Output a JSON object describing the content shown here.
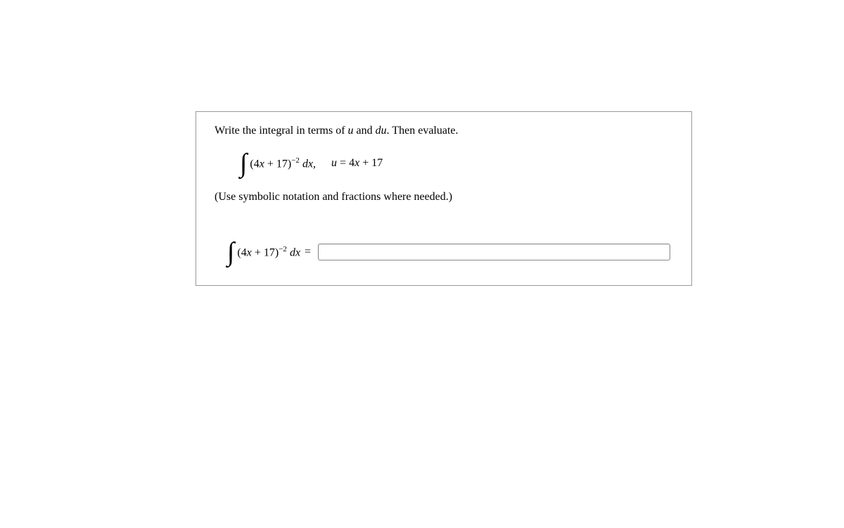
{
  "problem": {
    "instruction_prefix": "Write the integral in terms of ",
    "instruction_var1": "u",
    "instruction_mid": " and ",
    "instruction_var2": "du",
    "instruction_suffix": ". Then evaluate.",
    "integral_inner_open": "(4",
    "integral_inner_var": "x",
    "integral_inner_close": " + 17)",
    "integral_exponent": "−2",
    "integral_dx_space": " ",
    "integral_d": "d",
    "integral_x": "x",
    "integral_comma": ",",
    "sub_u": "u",
    "sub_eq": " = 4",
    "sub_x": "x",
    "sub_plus": " + 17",
    "note": "(Use symbolic notation and fractions where needed.)",
    "answer_integral_open": "(4",
    "answer_integral_var": "x",
    "answer_integral_close": " + 17)",
    "answer_exponent": "−2",
    "answer_d": "d",
    "answer_x": "x",
    "equals": "="
  }
}
